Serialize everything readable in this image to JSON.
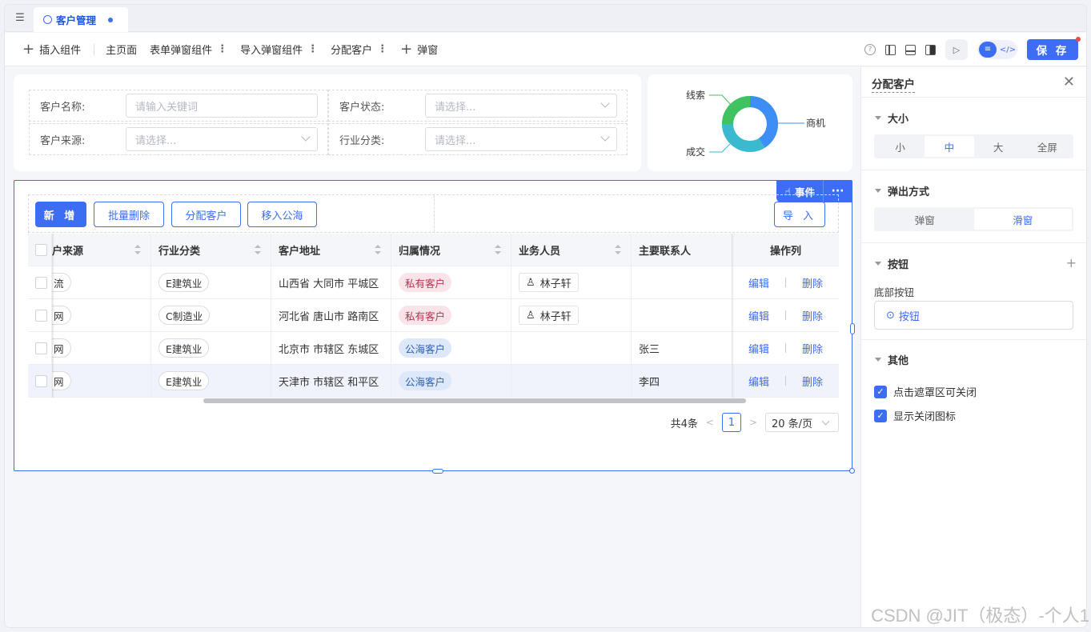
{
  "tab": {
    "title": "客户管理"
  },
  "toolbar": {
    "insert_component": "插入组件",
    "main_page": "主页面",
    "form_dialog": "表单弹窗组件",
    "import_dialog": "导入弹窗组件",
    "assign_customer": "分配客户",
    "popup": "弹窗",
    "save": "保 存"
  },
  "filters": {
    "customer_name_label": "客户名称:",
    "customer_name_placeholder": "请输入关键词",
    "customer_status_label": "客户状态:",
    "customer_status_placeholder": "请选择...",
    "customer_source_label": "客户来源:",
    "customer_source_placeholder": "请选择...",
    "industry_label": "行业分类:",
    "industry_placeholder": "请选择..."
  },
  "donut": {
    "labels": [
      "线索",
      "商机",
      "成交"
    ],
    "colors": {
      "lead": "#3fc25f",
      "opportunity": "#3d8ff5",
      "deal": "#3ab9cf"
    }
  },
  "event_bar": {
    "events": "事件",
    "more": "···"
  },
  "actions": {
    "add": "新 增",
    "batch_delete": "批量删除",
    "assign": "分配客户",
    "move_public": "移入公海",
    "import": "导 入"
  },
  "table": {
    "headers": [
      "户来源",
      "行业分类",
      "客户地址",
      "归属情况",
      "业务人员",
      "主要联系人",
      "操作列"
    ],
    "rows": [
      {
        "source": "流",
        "industry": "E建筑业",
        "address": "山西省 大同市 平城区",
        "ownership": "私有客户",
        "salesperson": "林子轩",
        "contact": "",
        "edit": "编辑",
        "delete": "删除"
      },
      {
        "source": "网",
        "industry": "C制造业",
        "address": "河北省 唐山市 路南区",
        "ownership": "私有客户",
        "salesperson": "林子轩",
        "contact": "",
        "edit": "编辑",
        "delete": "删除"
      },
      {
        "source": "网",
        "industry": "E建筑业",
        "address": "北京市 市辖区 东城区",
        "ownership": "公海客户",
        "salesperson": "",
        "contact": "张三",
        "edit": "编辑",
        "delete": "删除"
      },
      {
        "source": "网",
        "industry": "E建筑业",
        "address": "天津市 市辖区 和平区",
        "ownership": "公海客户",
        "salesperson": "",
        "contact": "李四",
        "edit": "编辑",
        "delete": "删除"
      }
    ]
  },
  "pager": {
    "total": "共4条",
    "page": "1",
    "size": "20 条/页"
  },
  "panel": {
    "title": "分配客户",
    "size_title": "大小",
    "size_options": [
      "小",
      "中",
      "大",
      "全屏"
    ],
    "mode_title": "弹出方式",
    "mode_options": [
      "弹窗",
      "滑窗"
    ],
    "button_title": "按钮",
    "bottom_button_label": "底部按钮",
    "button_item": "按钮",
    "other_title": "其他",
    "mask_close": "点击遮罩区可关闭",
    "show_close_icon": "显示关闭图标"
  },
  "watermark": "CSDN @JIT（极态）-个人1"
}
